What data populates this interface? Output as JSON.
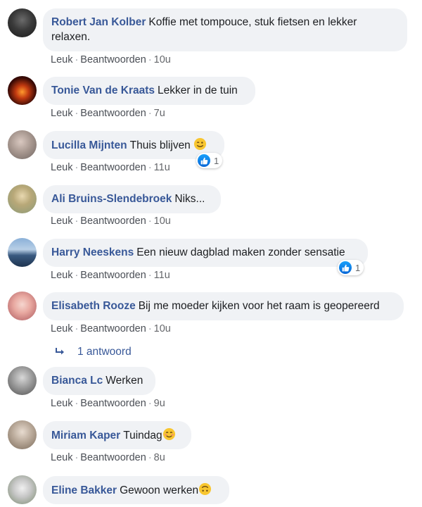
{
  "actions": {
    "like": "Leuk",
    "reply": "Beantwoorden",
    "separator": "·"
  },
  "comments": [
    {
      "author": "Robert Jan Kolber",
      "text": "Koffie met tompouce, stuk fietsen en lekker",
      "text2": "relaxen.",
      "time": "10u"
    },
    {
      "author": "Tonie Van de Kraats",
      "text": "Lekker in de tuin",
      "time": "7u"
    },
    {
      "author": "Lucilla Mijnten",
      "text": "Thuis blijven",
      "time": "11u",
      "reactions": "1"
    },
    {
      "author": "Ali Bruins-Slendebroek",
      "text": "Niks...",
      "time": "10u"
    },
    {
      "author": "Harry Neeskens",
      "text": "Een nieuw dagblad maken zonder sensatie",
      "time": "11u",
      "reactions": "1"
    },
    {
      "author": "Elisabeth Rooze",
      "text": "Bij me moeder kijken voor het raam is geopereerd",
      "time": "10u"
    },
    {
      "author": "Bianca Lc",
      "text": "Werken",
      "time": "9u"
    },
    {
      "author": "Miriam Kaper",
      "text": "Tuindag",
      "time": "8u"
    },
    {
      "author": "Eline Bakker",
      "text": "Gewoon werken"
    }
  ],
  "replies_link": "1 antwoord",
  "colors": {
    "author": "#385898",
    "bubble": "#f0f2f5",
    "like_blue": "#1877f2"
  },
  "icons": {
    "reaction": "like-thumb-icon",
    "reply_arrow": "reply-arrow-icon",
    "smile": "smile-emoji-icon",
    "wink": "wink-emoji-icon",
    "upside_down": "upside-down-emoji-icon"
  }
}
